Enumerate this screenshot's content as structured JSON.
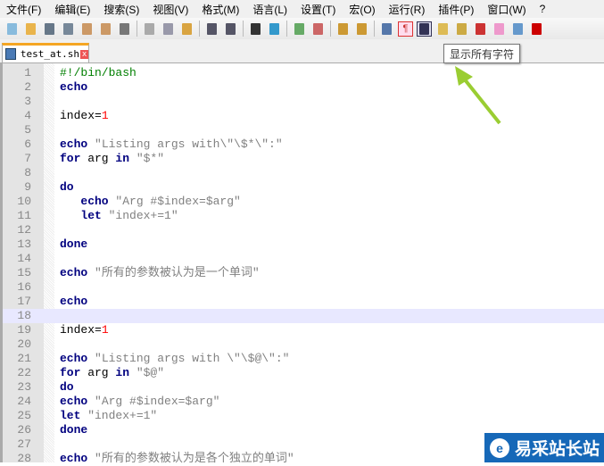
{
  "menu": [
    "文件(F)",
    "编辑(E)",
    "搜索(S)",
    "视图(V)",
    "格式(M)",
    "语言(L)",
    "设置(T)",
    "宏(O)",
    "运行(R)",
    "插件(P)",
    "窗口(W)",
    "?"
  ],
  "toolbar": {
    "tooltip": "显示所有字符",
    "icon_colors": [
      "#8bd",
      "#e9b44c",
      "#678",
      "#789",
      "#c96",
      "#c96",
      "#777",
      "#aaa",
      "#99a",
      "#d9a441",
      "#556",
      "#556",
      "#333",
      "#39c",
      "#6a6",
      "#c66",
      "#c93",
      "#c93",
      "#57a",
      "#c33",
      "#335",
      "#db5",
      "#ca4",
      "#c33",
      "#e9c",
      "#69c",
      "#c00"
    ]
  },
  "tab": {
    "title": "test_at.sh",
    "close": "x"
  },
  "editor": {
    "current_line": 18,
    "lines": [
      [
        {
          "c": "cm",
          "t": "#!/bin/bash"
        }
      ],
      [
        {
          "c": "kw",
          "t": "echo"
        }
      ],
      [],
      [
        {
          "c": "pl",
          "t": "index="
        },
        {
          "c": "num",
          "t": "1"
        }
      ],
      [],
      [
        {
          "c": "kw",
          "t": "echo"
        },
        {
          "c": "str",
          "t": " \"Listing args with\\\"\\$*\\\":\""
        }
      ],
      [
        {
          "c": "kw",
          "t": "for"
        },
        {
          "c": "pl",
          "t": " arg "
        },
        {
          "c": "kw",
          "t": "in"
        },
        {
          "c": "str",
          "t": " \"$*\""
        }
      ],
      [],
      [
        {
          "c": "kw",
          "t": "do"
        }
      ],
      [
        {
          "c": "kw",
          "t": "   echo"
        },
        {
          "c": "str",
          "t": " \"Arg #$index=$arg\""
        }
      ],
      [
        {
          "c": "kw",
          "t": "   let"
        },
        {
          "c": "str",
          "t": " \"index+=1\""
        }
      ],
      [],
      [
        {
          "c": "kw",
          "t": "done"
        }
      ],
      [],
      [
        {
          "c": "kw",
          "t": "echo"
        },
        {
          "c": "str",
          "t": " \"所有的参数被认为是一个单词\""
        }
      ],
      [],
      [
        {
          "c": "kw",
          "t": "echo"
        }
      ],
      [],
      [
        {
          "c": "pl",
          "t": "index="
        },
        {
          "c": "num",
          "t": "1"
        }
      ],
      [],
      [
        {
          "c": "kw",
          "t": "echo"
        },
        {
          "c": "str",
          "t": " \"Listing args with \\\"\\$@\\\":\""
        }
      ],
      [
        {
          "c": "kw",
          "t": "for"
        },
        {
          "c": "pl",
          "t": " arg "
        },
        {
          "c": "kw",
          "t": "in"
        },
        {
          "c": "str",
          "t": " \"$@\""
        }
      ],
      [
        {
          "c": "kw",
          "t": "do"
        }
      ],
      [
        {
          "c": "kw",
          "t": "echo"
        },
        {
          "c": "str",
          "t": " \"Arg #$index=$arg\""
        }
      ],
      [
        {
          "c": "kw",
          "t": "let"
        },
        {
          "c": "str",
          "t": " \"index+=1\""
        }
      ],
      [
        {
          "c": "kw",
          "t": "done"
        }
      ],
      [],
      [
        {
          "c": "kw",
          "t": "echo"
        },
        {
          "c": "str",
          "t": " \"所有的参数被认为是各个独立的单词\""
        }
      ]
    ]
  },
  "watermark": {
    "text": "易采站长站",
    "logo": "e"
  }
}
